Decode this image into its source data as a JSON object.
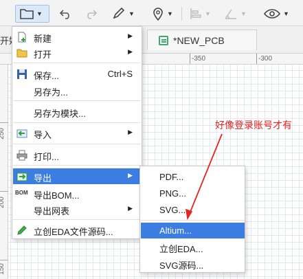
{
  "tabs": {
    "left_partial": "开始",
    "active": "*NEW_PCB"
  },
  "ruler": {
    "top": [
      "-350",
      "-300"
    ],
    "left": [
      "250",
      "200",
      "150"
    ]
  },
  "menu": {
    "new": "新建",
    "open": "打开",
    "save": "保存...",
    "save_shortcut": "Ctrl+S",
    "save_as": "另存为...",
    "save_as_module": "另存为模块...",
    "import": "导入",
    "print": "打印...",
    "export": "导出",
    "export_bom": "导出BOM...",
    "bom_badge": "BOM",
    "export_netlist": "导出网表",
    "lceda_source": "立创EDA文件源码..."
  },
  "submenu": {
    "pdf": "PDF...",
    "png": "PNG...",
    "svg": "SVG...",
    "altium": "Altium...",
    "lceda": "立创EDA...",
    "svg_source": "SVG源码..."
  },
  "annotation": "好像登录账号才有",
  "colors": {
    "highlight": "#3b7de0",
    "annotation": "#e8231f",
    "accent_green": "#3fa86b"
  }
}
